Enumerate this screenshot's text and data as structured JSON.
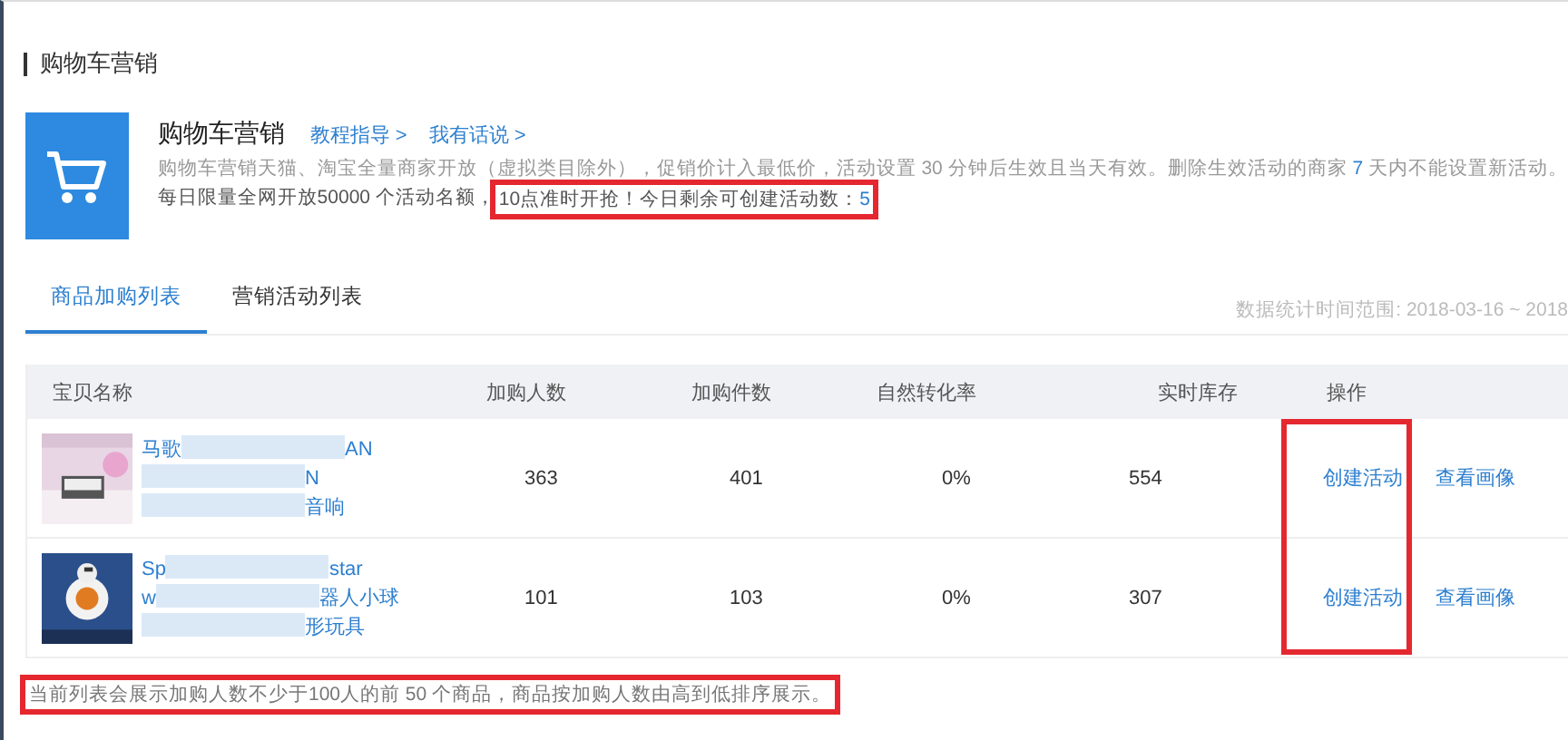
{
  "section_title": "购物车营销",
  "intro": {
    "title": "购物车营销",
    "links": [
      "教程指导 >",
      "我有话说 >"
    ],
    "description_parts": [
      "购物车营销天猫、淘宝全量商家开放（",
      "虚拟类目除外",
      "），促销价计入最低价，活动设置 30 分钟后生效且当天有效。删除生效活动的商家 ",
      "7",
      " 天内不能设置新活动。"
    ],
    "notice": {
      "text": "每日限量全网开放50000 个活动名额，",
      "highlight": "10点准时开抢！今日剩余可创建活动数：",
      "count": "5",
      "highlighted": true
    }
  },
  "tabs": [
    {
      "label": "商品加购列表",
      "selected": true
    },
    {
      "label": "营销活动列表",
      "selected": false
    }
  ],
  "date_range": "数据统计时间范围: 2018-03-16 ~ 2018",
  "table": {
    "columns": [
      "宝贝名称",
      "加购人数",
      "加购件数",
      "自然转化率",
      "实时库存",
      "操作"
    ],
    "action_highlighted": true,
    "rows": [
      {
        "name_lines": [
          {
            "before": "马歌",
            "after": "AN"
          },
          {
            "after": "N"
          },
          {
            "after": "音响"
          }
        ],
        "add_users": "363",
        "add_items": "401",
        "conversion": "0%",
        "stock": "554",
        "actions": [
          "创建活动",
          "查看画像"
        ]
      },
      {
        "name_lines": [
          {
            "before": "Sp",
            "after": "star"
          },
          {
            "before": "w",
            "after": "器人小球"
          },
          {
            "after": "形玩具"
          }
        ],
        "add_users": "101",
        "add_items": "103",
        "conversion": "0%",
        "stock": "307",
        "actions": [
          "创建活动",
          "查看画像"
        ]
      }
    ]
  },
  "footer_note": {
    "text": "当前列表会展示加购人数不少于100人的前 50 个商品，商品按加购人数由高到低排序展示。",
    "highlighted": true
  }
}
